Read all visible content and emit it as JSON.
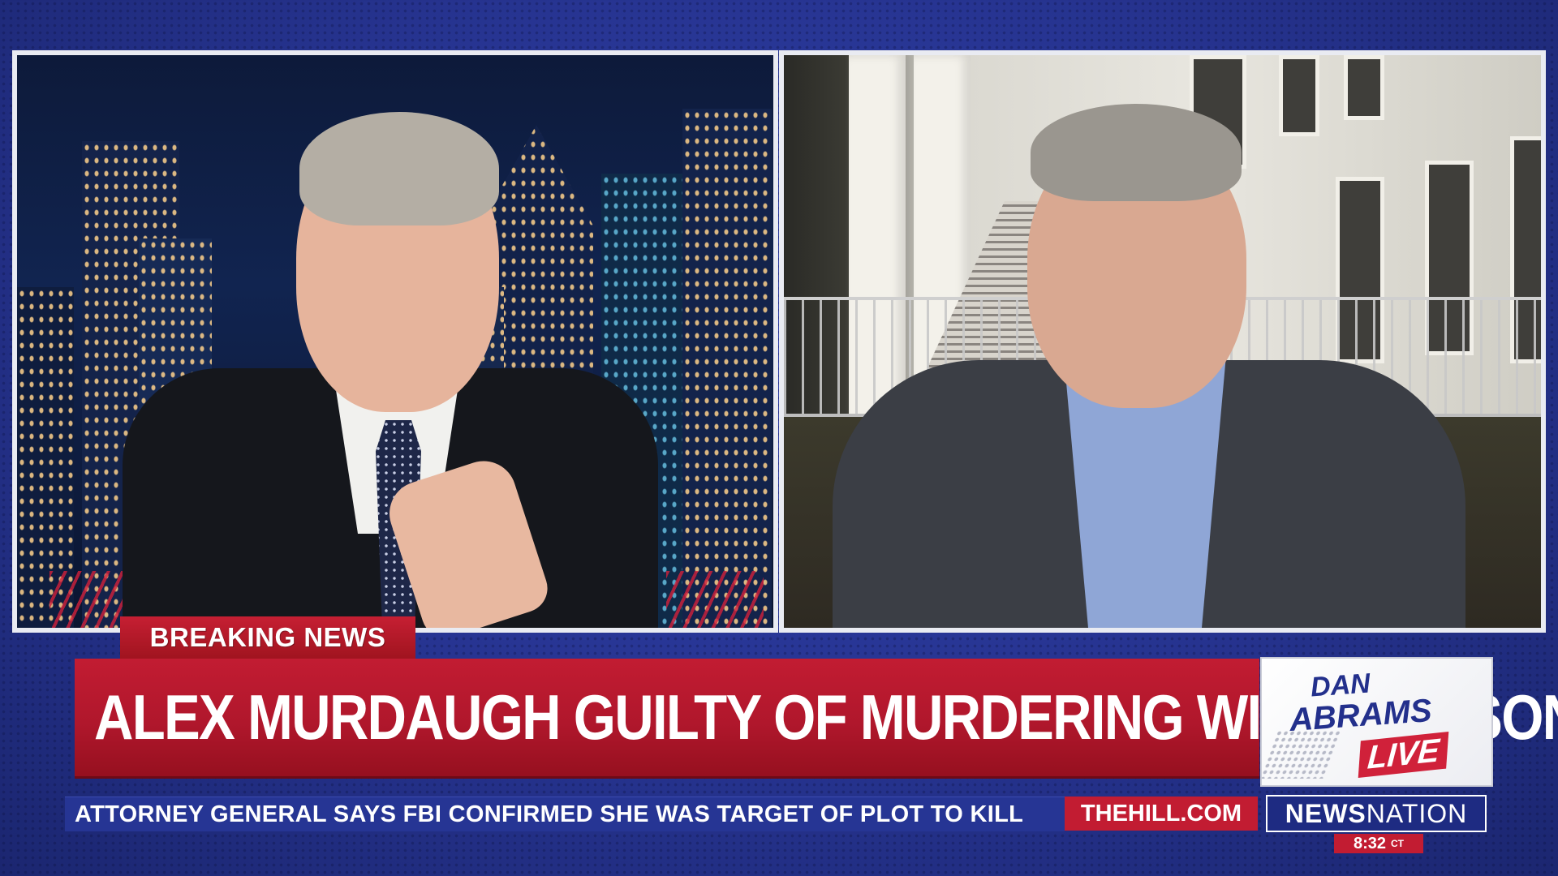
{
  "lower_third": {
    "tag": "BREAKING NEWS",
    "headline": "ALEX MURDAUGH GUILTY OF MURDERING WIFE AND SON"
  },
  "ticker": {
    "text": "ATTORNEY GENERAL SAYS FBI CONFIRMED SHE WAS TARGET OF PLOT TO KILL",
    "site": "THEHILL.COM"
  },
  "show_logo": {
    "line1": "DAN",
    "line2": "ABRAMS",
    "line3": "LIVE"
  },
  "network": {
    "part1": "NEWS",
    "part2": "NATION"
  },
  "clock": {
    "time": "8:32",
    "zone": "CT"
  },
  "colors": {
    "brand_red": "#c21c32",
    "brand_blue": "#263594"
  }
}
